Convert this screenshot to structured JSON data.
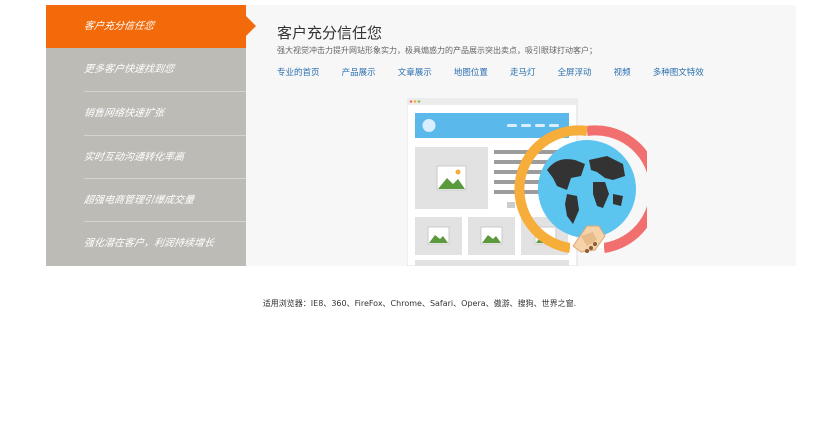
{
  "sidebar": {
    "items": [
      {
        "label": "客户充分信任您",
        "active": true
      },
      {
        "label": "更多客户快速找到您",
        "active": false
      },
      {
        "label": "销售网络快速扩张",
        "active": false
      },
      {
        "label": "实时互动沟通转化率高",
        "active": false
      },
      {
        "label": "超强电商管理引爆成交量",
        "active": false
      },
      {
        "label": "强化潜在客户，利润持续增长",
        "active": false
      }
    ]
  },
  "main": {
    "title": "客户充分信任您",
    "description": "强大视觉冲击力提升网站形象实力，极具煽惑力的产品展示突出卖点，吸引眼球打动客户；",
    "features": [
      "专业的首页",
      "产品展示",
      "文章展示",
      "地图位置",
      "走马灯",
      "全屏浮动",
      "视频",
      "多种图文特效"
    ]
  },
  "footer": {
    "browsers": "适用浏览器：IE8、360、FireFox、Chrome、Safari、Opera、傲游、搜狗、世界之窗."
  },
  "colors": {
    "accent": "#f26a0a",
    "sidebar": "#bdbbb6",
    "link": "#2a6fb0",
    "globe": "#5bc4ef",
    "ring_orange": "#f7ad3a",
    "ring_red": "#f26f6f"
  }
}
